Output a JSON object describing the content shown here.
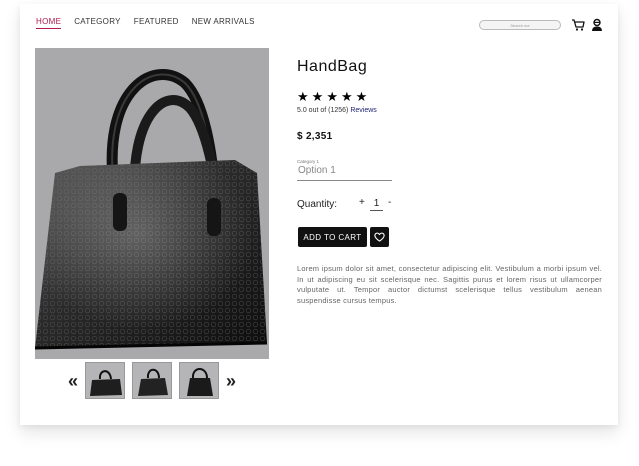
{
  "nav": {
    "items": [
      {
        "label": "HOME",
        "active": true
      },
      {
        "label": "CATEGORY"
      },
      {
        "label": "FEATURED"
      },
      {
        "label": "NEW ARRIVALS"
      }
    ],
    "search_placeholder": "Search me",
    "icons": [
      "cart-icon",
      "user-icon"
    ]
  },
  "product": {
    "title": "HandBag",
    "rating_stars": 5,
    "rating_text": "5.0 out of (1256)",
    "reviews_link": "Reviews",
    "price": "$ 2,351",
    "category_label": "Category 1",
    "category_value": "Option 1",
    "quantity_label": "Quantity:",
    "quantity_plus": "+",
    "quantity_value": "1",
    "quantity_minus": "-",
    "add_to_cart": "ADD TO CART",
    "description": "Lorem ipsum dolor sit amet, consectetur adipiscing elit. Vestibulum a morbi ipsum vel. In ut adipiscing eu sit scelerisque nec. Sagittis purus et lorem risus ut ullamcorper vulputate ut. Tempor auctor dictumst scelerisque tellus vestibulum aenean suspendisse cursus tempus."
  },
  "gallery": {
    "prev_arrow": "«",
    "next_arrow": "»",
    "thumbnail_count": 3
  },
  "colors": {
    "accent": "#b0194a",
    "button": "#111111",
    "link": "#1b1f6b",
    "image_bg": "#a9a9ab"
  }
}
